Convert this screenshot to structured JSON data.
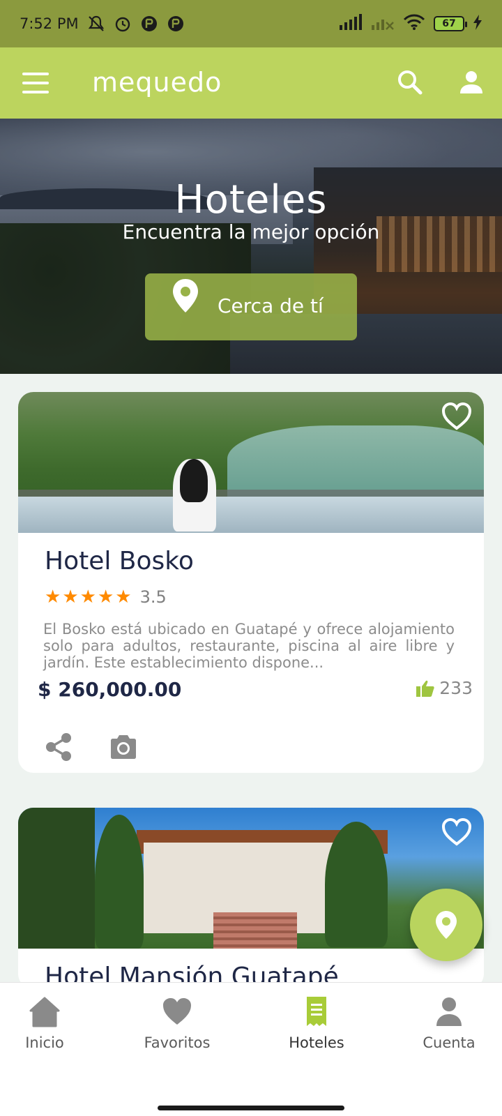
{
  "status_bar": {
    "time": "7:52 PM",
    "battery": "67"
  },
  "app_bar": {
    "logo": "mequedo",
    "icons": [
      "menu-icon",
      "search-icon",
      "user-icon"
    ]
  },
  "hero": {
    "title": "Hoteles",
    "subtitle": "Encuentra la mejor opción",
    "near_button": "Cerca de tí"
  },
  "hotels": [
    {
      "name": "Hotel Bosko",
      "rating": "3.5",
      "stars": 5,
      "description": "El Bosko está ubicado en Guatapé y ofrece alojamiento solo para adultos, restaurante, piscina al aire libre y jardín. Este establecimiento dispone...",
      "price": "$ 260,000.00",
      "likes": "233"
    },
    {
      "name": "Hotel Mansión Guatapé"
    }
  ],
  "bottom_nav": {
    "items": [
      {
        "label": "Inicio",
        "icon": "home-icon"
      },
      {
        "label": "Favoritos",
        "icon": "heart-icon"
      },
      {
        "label": "Hoteles",
        "icon": "hotel-icon"
      },
      {
        "label": "Cuenta",
        "icon": "account-icon"
      }
    ],
    "active": "Hoteles"
  },
  "colors": {
    "status_bar": "#8b9a3e",
    "app_bar": "#bcd45e",
    "accent": "#b9d45e",
    "star": "#ff8a00",
    "title_text": "#1f2746"
  }
}
